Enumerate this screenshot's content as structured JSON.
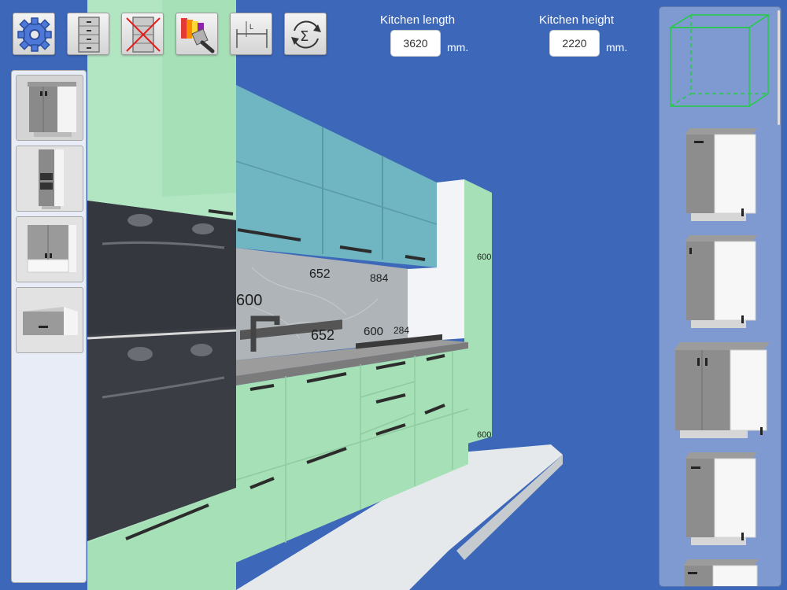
{
  "header": {
    "kitchen_length_label": "Kitchen length",
    "kitchen_length_value": "3620",
    "kitchen_height_label": "Kitchen height",
    "kitchen_height_value": "2220",
    "unit": "mm."
  },
  "toolbar": [
    {
      "icon": "gear-icon"
    },
    {
      "icon": "drawer-cabinet-icon"
    },
    {
      "icon": "delete-cabinet-icon"
    },
    {
      "icon": "paint-brush-icon"
    },
    {
      "icon": "measure-length-icon"
    },
    {
      "icon": "sum-cycle-icon"
    }
  ],
  "categories": [
    {
      "icon": "base-cabinet-icon"
    },
    {
      "icon": "tall-oven-cabinet-icon"
    },
    {
      "icon": "wall-cabinet-icon"
    },
    {
      "icon": "hood-cabinet-icon"
    }
  ],
  "scene": {
    "dimensions": [
      "600",
      "652",
      "884",
      "652",
      "600",
      "284",
      "600",
      "600"
    ]
  },
  "colors": {
    "background": "#3d67b8",
    "cabinet_front": "#a6e0b7",
    "wall_cabinet": "#6fb5c2",
    "appliance": "#3a3d44",
    "panel": "#7e9ad0"
  }
}
